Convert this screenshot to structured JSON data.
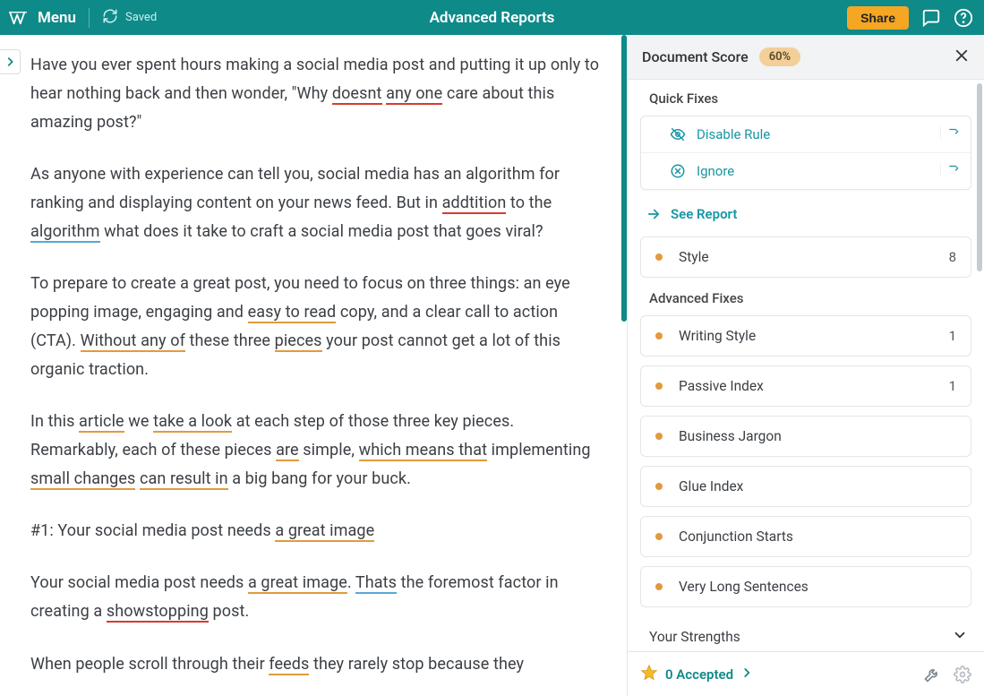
{
  "header": {
    "menu": "Menu",
    "saved": "Saved",
    "title": "Advanced Reports",
    "share": "Share"
  },
  "editor": {
    "p1a": "Have you ever spent hours making a social media post and putting it up only to hear nothing back and then wonder, \"Why ",
    "p1_doesnt": "doesnt",
    "p1b": " ",
    "p1_anyone": "any one",
    "p1c": " care about this amazing post?\"",
    "p2a": "As anyone with experience can tell you, social media has an algorithm for ranking and displaying content on your news feed. But in ",
    "p2_addtition": "addtition",
    "p2b": " to the ",
    "p2_algorithm": "algorithm",
    "p2c": " what does it take to craft a social media post that goes viral?",
    "p3a": "To prepare to create a great post, you need to focus on three things: an eye popping image, engaging and ",
    "p3_easy": "easy to read",
    "p3b": "  copy, and a clear call to action (CTA). ",
    "p3_without": "Without any of",
    "p3c": " these three ",
    "p3_pieces": "pieces",
    "p3d": " your post cannot get a lot of this organic traction.",
    "p4a": "In this ",
    "p4_article": "article",
    "p4b": " we ",
    "p4_take": "take a look",
    "p4c": " at each step of those three key pieces. Remarkably, each of these pieces ",
    "p4_are": "are",
    "p4d": " simple, ",
    "p4_which": "which means that",
    "p4e": " implementing ",
    "p4_small": "small changes",
    "p4f": " ",
    "p4_result": "can result in",
    "p4g": " a big bang for your buck.",
    "p5a": "#1: Your social media post needs ",
    "p5_great": "a great image",
    "p6a": "Your social media post needs ",
    "p6_great": "a great image",
    "p6b": ". ",
    "p6_thats": "Thats",
    "p6c": " the foremost factor in creating a ",
    "p6_show": "showstopping",
    "p6d": " post.",
    "p7a": "When people scroll through their ",
    "p7_feeds": "feeds",
    "p7b": " they rarely stop because they"
  },
  "panel": {
    "score_label": "Document Score",
    "score_value": "60%",
    "quick_fixes_title": "Quick Fixes",
    "actions": {
      "disable": "Disable Rule",
      "ignore": "Ignore"
    },
    "see_report": "See Report",
    "style_card": {
      "label": "Style",
      "count": "8"
    },
    "advanced_title": "Advanced Fixes",
    "cards": [
      {
        "label": "Writing Style",
        "count": "1"
      },
      {
        "label": "Passive Index",
        "count": "1"
      },
      {
        "label": "Business Jargon",
        "count": ""
      },
      {
        "label": "Glue Index",
        "count": ""
      },
      {
        "label": "Conjunction Starts",
        "count": ""
      },
      {
        "label": "Very Long Sentences",
        "count": ""
      }
    ],
    "strengths": "Your Strengths",
    "footer": {
      "accepted": "0 Accepted"
    }
  }
}
